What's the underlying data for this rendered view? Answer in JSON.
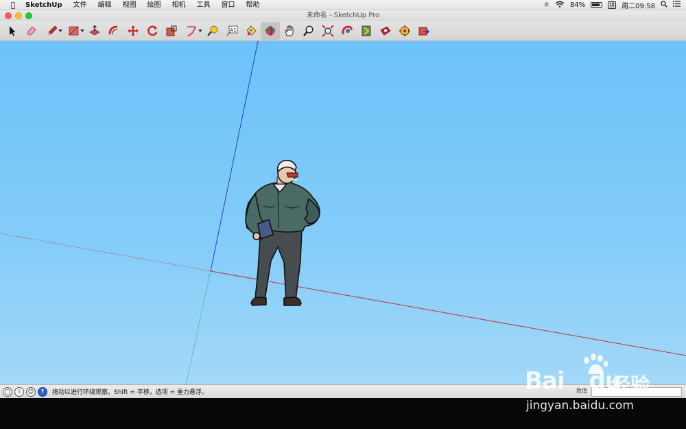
{
  "menubar": {
    "app": "SketchUp",
    "items": [
      "文件",
      "编辑",
      "视图",
      "绘图",
      "相机",
      "工具",
      "窗口",
      "帮助"
    ],
    "battery": "84%",
    "ime": "拼",
    "clock": "周二09:58"
  },
  "window": {
    "title": "未命名 - SketchUp Pro"
  },
  "toolbar": {
    "tools": [
      {
        "name": "select-tool",
        "icon": "arrow-icon"
      },
      {
        "name": "eraser-tool",
        "icon": "eraser-icon"
      },
      {
        "name": "line-tool",
        "icon": "pencil-icon",
        "dropdown": true
      },
      {
        "name": "rectangle-tool",
        "icon": "rectangle-icon",
        "dropdown": true
      },
      {
        "name": "push-pull-tool",
        "icon": "push-pull-icon"
      },
      {
        "name": "offset-tool",
        "icon": "offset-icon"
      },
      {
        "name": "move-tool",
        "icon": "move-icon"
      },
      {
        "name": "rotate-tool",
        "icon": "rotate-icon"
      },
      {
        "name": "scale-tool",
        "icon": "scale-icon"
      },
      {
        "name": "arc-tool",
        "icon": "arc-icon",
        "dropdown": true
      },
      {
        "name": "tape-measure-tool",
        "icon": "tape-measure-icon"
      },
      {
        "name": "text-tool",
        "icon": "text-icon"
      },
      {
        "name": "paint-bucket-tool",
        "icon": "paint-bucket-icon"
      },
      {
        "name": "orbit-tool",
        "icon": "orbit-icon",
        "active": true
      },
      {
        "name": "pan-tool",
        "icon": "hand-icon"
      },
      {
        "name": "zoom-tool",
        "icon": "magnifier-icon"
      },
      {
        "name": "zoom-extents-tool",
        "icon": "zoom-extents-icon"
      },
      {
        "name": "3d-warehouse-tool",
        "icon": "warehouse-icon"
      },
      {
        "name": "extension-warehouse-tool",
        "icon": "extension-icon"
      },
      {
        "name": "layout-tool",
        "icon": "layout-icon"
      },
      {
        "name": "extension-manager-tool",
        "icon": "gear-icon"
      },
      {
        "name": "send-to-layout-tool",
        "icon": "send-icon"
      }
    ],
    "text_tool_label": "A1"
  },
  "statusbar": {
    "text": "拖动以进行环绕观察。Shift = 平移，选项 = 重力悬浮。",
    "measure_label": "数值",
    "help_glyph": "?"
  },
  "watermark": {
    "logo": "Bai",
    "logo2": "du",
    "cn": "经验",
    "url": "jingyan.baidu.com"
  },
  "colors": {
    "sky": "#6cc2f9",
    "axis_red": "#c0303a",
    "axis_green": "#1fa34a",
    "axis_blue": "#2040c0"
  }
}
